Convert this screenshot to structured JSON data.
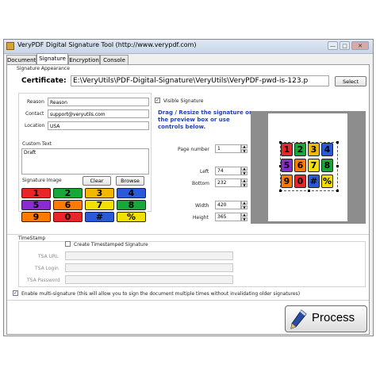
{
  "window": {
    "title": "VeryPDF Digital Signature Tool (http://www.verypdf.com)",
    "buttons": [
      "—",
      "□",
      "✕"
    ]
  },
  "tabs": [
    "Document",
    "Signature",
    "Encryption",
    "Console"
  ],
  "active_tab": "Signature",
  "appearance": {
    "group_label": "Signature Appearance",
    "certificate_label": "Certificate:",
    "certificate_value": "E:\\VeryUtils\\PDF-Digital-Signature\\VeryUtils\\VeryPDF-pwd-is-123.p",
    "select_button": "Select",
    "reason_label": "Reason",
    "reason_value": "Reason",
    "contact_label": "Contact",
    "contact_value": "support@veryutils.com",
    "location_label": "Location",
    "location_value": "USA",
    "custom_text_label": "Custom Text",
    "custom_text_value": "Draft",
    "signature_image_label": "Signature Image",
    "clear_button": "Clear",
    "browse_button": "Browse",
    "visible_signature_label": "Visible Signature",
    "visible_signature_checked": true,
    "hint": "Drag / Resize the signature on the preview box or use controls below.",
    "page_number_label": "Page number",
    "page_number_value": "1",
    "left_label": "Left",
    "left_value": "74",
    "bottom_label": "Bottom",
    "bottom_value": "232",
    "width_label": "Width",
    "width_value": "420",
    "height_label": "Height",
    "height_value": "365"
  },
  "tiles": [
    {
      "label": "1",
      "color": "#e8262a"
    },
    {
      "label": "2",
      "color": "#18a83a"
    },
    {
      "label": "3",
      "color": "#f2b800"
    },
    {
      "label": "4",
      "color": "#2a5ad8"
    },
    {
      "label": "5",
      "color": "#8a2bd2"
    },
    {
      "label": "6",
      "color": "#ff7a00"
    },
    {
      "label": "7",
      "color": "#f2e000"
    },
    {
      "label": "8",
      "color": "#18a83a"
    },
    {
      "label": "9",
      "color": "#ff7a00"
    },
    {
      "label": "0",
      "color": "#e8262a"
    },
    {
      "label": "#",
      "color": "#2a5ad8"
    },
    {
      "label": "%",
      "color": "#f2e000"
    }
  ],
  "timestamp": {
    "group_label": "TimeStamp",
    "create_label": "Create Timestamped Signature",
    "create_checked": false,
    "tsa_url_label": "TSA URL",
    "tsa_login_label": "TSA Login",
    "tsa_password_label": "TSA Password"
  },
  "multi_signature": {
    "label": "Enable multi-signature (this will allow you to sign the document multiple times without invalidating older signatures)",
    "checked": true
  },
  "process_button": "Process"
}
